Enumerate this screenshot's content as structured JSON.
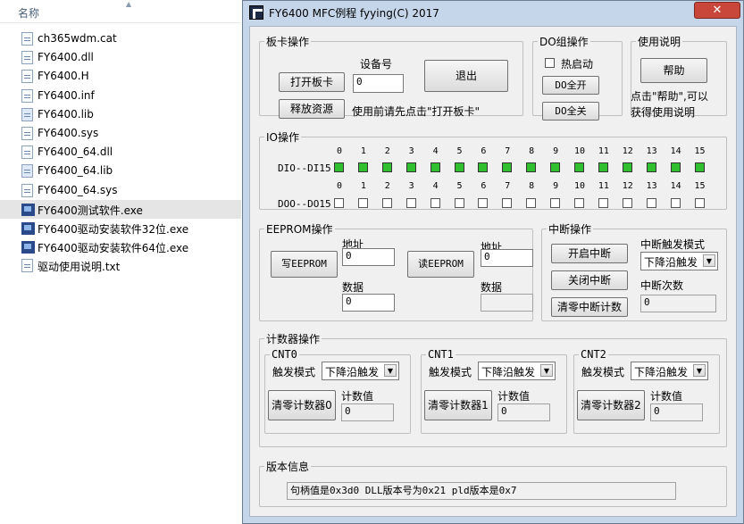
{
  "explorer": {
    "column_name": "名称",
    "files": [
      {
        "name": "ch365wdm.cat",
        "icon": "document-icon"
      },
      {
        "name": "FY6400.dll",
        "icon": "document-icon"
      },
      {
        "name": "FY6400.H",
        "icon": "document-icon"
      },
      {
        "name": "FY6400.inf",
        "icon": "document-icon"
      },
      {
        "name": "FY6400.lib",
        "icon": "library-icon"
      },
      {
        "name": "FY6400.sys",
        "icon": "document-icon"
      },
      {
        "name": "FY6400_64.dll",
        "icon": "document-icon"
      },
      {
        "name": "FY6400_64.lib",
        "icon": "library-icon"
      },
      {
        "name": "FY6400_64.sys",
        "icon": "document-icon"
      },
      {
        "name": "FY6400测试软件.exe",
        "icon": "app-icon"
      },
      {
        "name": "FY6400驱动安装软件32位.exe",
        "icon": "installer-icon"
      },
      {
        "name": "FY6400驱动安装软件64位.exe",
        "icon": "installer-icon"
      },
      {
        "name": "驱动使用说明.txt",
        "icon": "document-icon"
      }
    ],
    "selected_index": 9
  },
  "window": {
    "title": "FY6400 MFC例程 fyying(C) 2017",
    "close_label": "✕"
  },
  "board": {
    "legend": "板卡操作",
    "device_label": "设备号",
    "device_value": "0",
    "open_label": "打开板卡",
    "release_label": "释放资源",
    "exit_label": "退出",
    "hint": "使用前请先点击\"打开板卡\""
  },
  "do_group": {
    "legend": "DO组操作",
    "hotstart_label": "热启动",
    "all_on_label": "DO全开",
    "all_off_label": "DO全关"
  },
  "help": {
    "legend": "使用说明",
    "button_label": "帮助",
    "text": "点击\"帮助\",可以获得使用说明"
  },
  "io": {
    "legend": "IO操作",
    "di_label": "DIO--DI15",
    "do_label": "DOO--DO15",
    "channels": [
      "0",
      "1",
      "2",
      "3",
      "4",
      "5",
      "6",
      "7",
      "8",
      "9",
      "10",
      "11",
      "12",
      "13",
      "14",
      "15"
    ],
    "di_color": "#2fbf2f"
  },
  "eeprom": {
    "legend": "EEPROM操作",
    "addr_label": "地址",
    "data_label": "数据",
    "write_label": "写EEPROM",
    "read_label": "读EEPROM",
    "write_addr": "0",
    "write_data": "0",
    "read_addr": "0",
    "read_data": ""
  },
  "interrupt": {
    "legend": "中断操作",
    "open_label": "开启中断",
    "close_label": "关闭中断",
    "clear_label": "清零中断计数",
    "mode_label": "中断触发模式",
    "mode_value": "下降沿触发",
    "count_label": "中断次数",
    "count_value": "0"
  },
  "counter": {
    "legend": "计数器操作",
    "trigger_label": "触发模式",
    "value_label": "计数值",
    "channels": [
      {
        "legend": "CNT0",
        "mode": "下降沿触发",
        "clear_label": "清零计数器0",
        "value": "0"
      },
      {
        "legend": "CNT1",
        "mode": "下降沿触发",
        "clear_label": "清零计数器1",
        "value": "0"
      },
      {
        "legend": "CNT2",
        "mode": "下降沿触发",
        "clear_label": "清零计数器2",
        "value": "0"
      }
    ]
  },
  "version": {
    "legend": "版本信息",
    "text": "句柄值是0x3d0  DLL版本号为0x21  pld版本是0x7"
  },
  "colors": {
    "window_frame": "#c5d6ea",
    "close_button": "#c8473a",
    "led_on": "#2fbf2f"
  }
}
